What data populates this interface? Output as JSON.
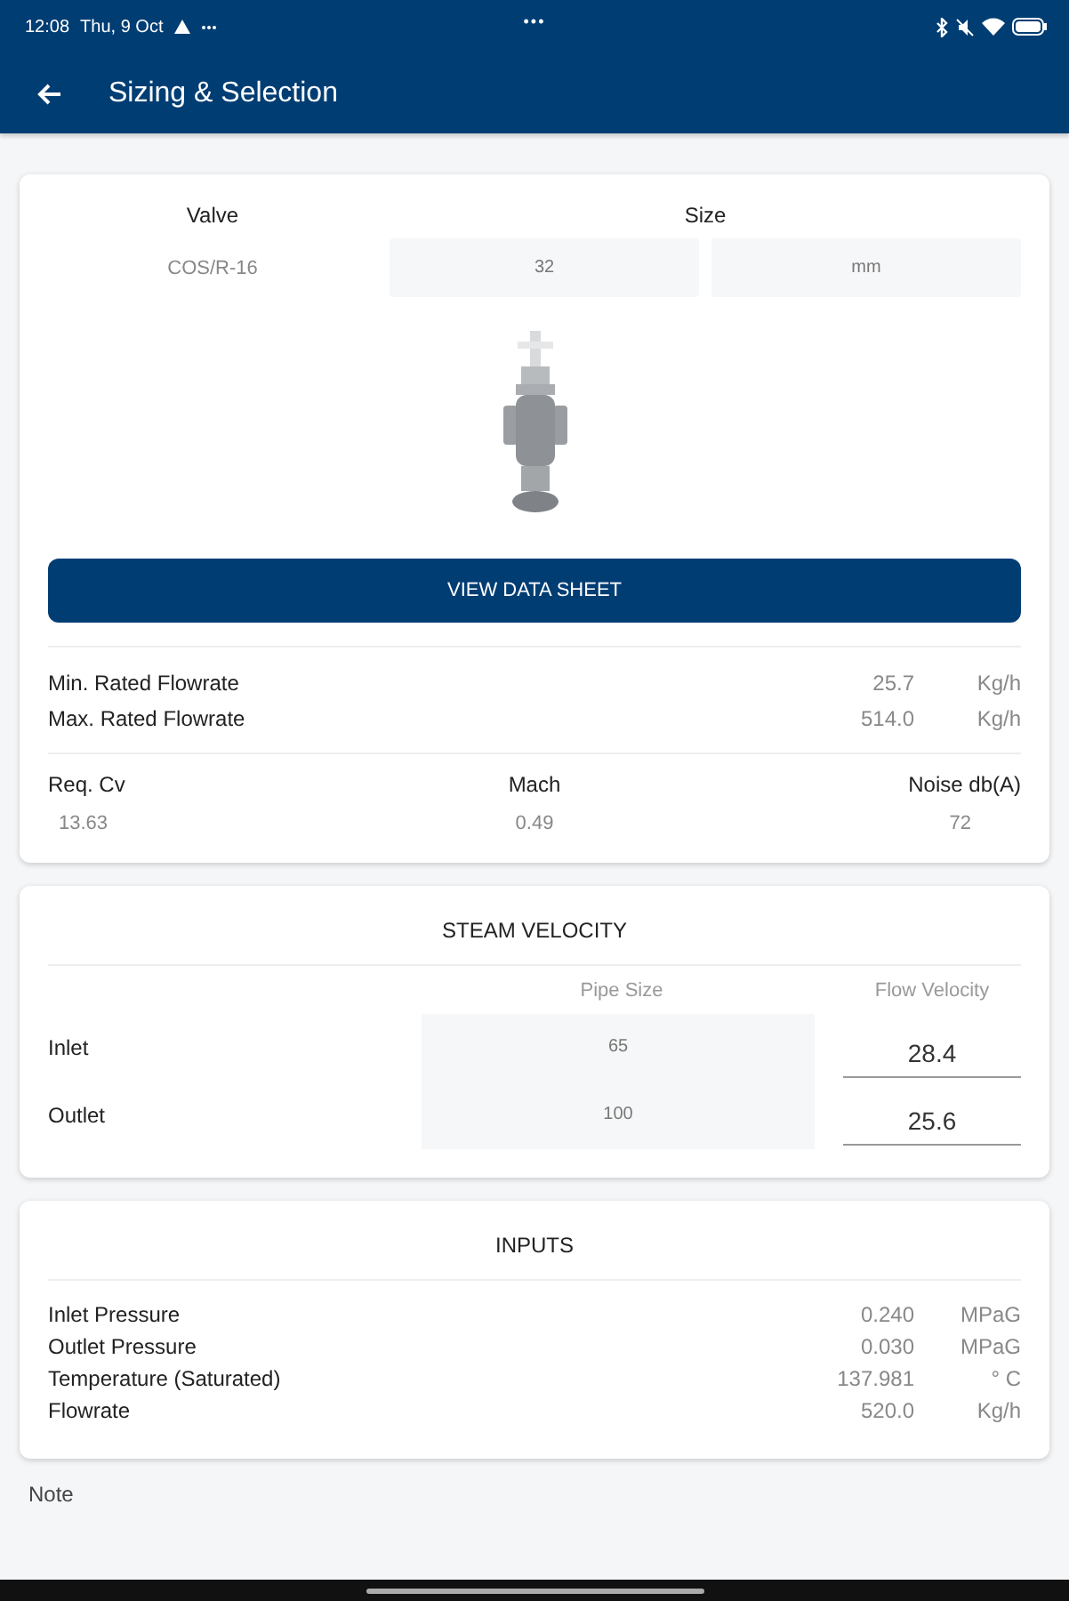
{
  "status_bar": {
    "time": "12:08",
    "date": "Thu, 9 Oct",
    "dots": "•••"
  },
  "app_bar": {
    "title": "Sizing & Selection"
  },
  "valve_card": {
    "valve_label": "Valve",
    "size_label": "Size",
    "valve": "COS/R-16",
    "size": "32",
    "size_unit": "mm",
    "button": "VIEW DATA SHEET",
    "flowrates": [
      {
        "label": "Min. Rated Flowrate",
        "value": "25.7",
        "unit": "Kg/h"
      },
      {
        "label": "Max. Rated Flowrate",
        "value": "514.0",
        "unit": "Kg/h"
      }
    ],
    "stats": [
      {
        "label": "Req. Cv",
        "value": "13.63"
      },
      {
        "label": "Mach",
        "value": "0.49"
      },
      {
        "label": "Noise db(A)",
        "value": "72"
      }
    ]
  },
  "steam_velocity": {
    "title": "STEAM VELOCITY",
    "columns": [
      "Pipe Size",
      "Flow Velocity"
    ],
    "rows": [
      {
        "label": "Inlet",
        "pipe_size": "65",
        "velocity": "28.4"
      },
      {
        "label": "Outlet",
        "pipe_size": "100",
        "velocity": "25.6"
      }
    ]
  },
  "inputs": {
    "title": "INPUTS",
    "rows": [
      {
        "label": "Inlet Pressure",
        "value": "0.240",
        "unit": "MPaG"
      },
      {
        "label": "Outlet Pressure",
        "value": "0.030",
        "unit": "MPaG"
      },
      {
        "label": "Temperature (Saturated)",
        "value": "137.981",
        "unit": "° C"
      },
      {
        "label": "Flowrate",
        "value": "520.0",
        "unit": "Kg/h"
      }
    ]
  },
  "note": {
    "label": "Note"
  }
}
